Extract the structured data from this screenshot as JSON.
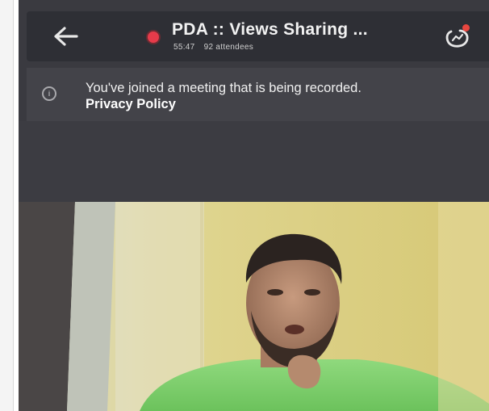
{
  "header": {
    "title": "PDA :: Views Sharing ...",
    "duration": "55:47",
    "attendees": "92 attendees",
    "back_icon": "arrow-left-icon",
    "share_icon": "share-screen-icon",
    "recording_color": "#e63b4a"
  },
  "banner": {
    "message": "You've joined a meeting that is being recorded.",
    "link": "Privacy Policy",
    "icon": "info-icon"
  },
  "video": {
    "description": "participant-camera-feed"
  },
  "colors": {
    "app_bg": "#3a3a40",
    "header_bg": "#2e2f35",
    "banner_bg": "#434349",
    "video_wall": "#d8cd7e",
    "shirt": "#7fd06e"
  }
}
